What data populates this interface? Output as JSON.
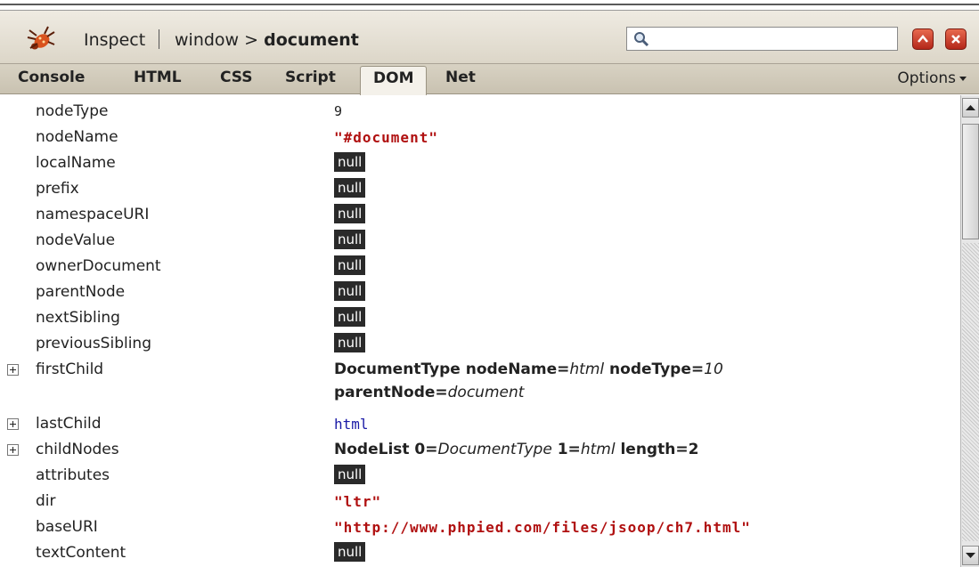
{
  "toolbar": {
    "inspect_label": "Inspect",
    "crumbs": {
      "parent": "window",
      "separator": ">",
      "current": "document"
    },
    "search_value": ""
  },
  "tabs": [
    {
      "label": "Console",
      "active": false
    },
    {
      "label": "HTML",
      "active": false
    },
    {
      "label": "CSS",
      "active": false
    },
    {
      "label": "Script",
      "active": false
    },
    {
      "label": "DOM",
      "active": true
    },
    {
      "label": "Net",
      "active": false
    }
  ],
  "options_label": "Options",
  "properties": [
    {
      "name": "nodeType",
      "value": "9",
      "kind": "number"
    },
    {
      "name": "nodeName",
      "value": "\"#document\"",
      "kind": "string"
    },
    {
      "name": "localName",
      "value": "null",
      "kind": "null"
    },
    {
      "name": "prefix",
      "value": "null",
      "kind": "null"
    },
    {
      "name": "namespaceURI",
      "value": "null",
      "kind": "null"
    },
    {
      "name": "nodeValue",
      "value": "null",
      "kind": "null"
    },
    {
      "name": "ownerDocument",
      "value": "null",
      "kind": "null"
    },
    {
      "name": "parentNode",
      "value": "null",
      "kind": "null"
    },
    {
      "name": "nextSibling",
      "value": "null",
      "kind": "null"
    },
    {
      "name": "previousSibling",
      "value": "null",
      "kind": "null"
    },
    {
      "name": "firstChild",
      "expandable": true,
      "kind": "object",
      "parts1": [
        {
          "t": "DocumentType nodeName=",
          "em": false
        },
        {
          "t": "html",
          "em": true
        },
        {
          "t": " nodeType=",
          "em": false
        },
        {
          "t": "10",
          "em": true
        }
      ],
      "parts2": [
        {
          "t": "parentNode=",
          "em": false
        },
        {
          "t": "document",
          "em": true
        }
      ]
    },
    {
      "name": "lastChild",
      "value": "html",
      "kind": "tag",
      "expandable": true
    },
    {
      "name": "childNodes",
      "expandable": true,
      "kind": "object",
      "parts1": [
        {
          "t": "NodeList 0=",
          "em": false
        },
        {
          "t": "DocumentType",
          "em": true
        },
        {
          "t": " 1=",
          "em": false
        },
        {
          "t": "html",
          "em": true
        },
        {
          "t": " length=2",
          "em": false
        }
      ]
    },
    {
      "name": "attributes",
      "value": "null",
      "kind": "null"
    },
    {
      "name": "dir",
      "value": "\"ltr\"",
      "kind": "string"
    },
    {
      "name": "baseURI",
      "value": "\"http://www.phpied.com/files/jsoop/ch7.html\"",
      "kind": "string"
    },
    {
      "name": "textContent",
      "value": "null",
      "kind": "null"
    }
  ]
}
